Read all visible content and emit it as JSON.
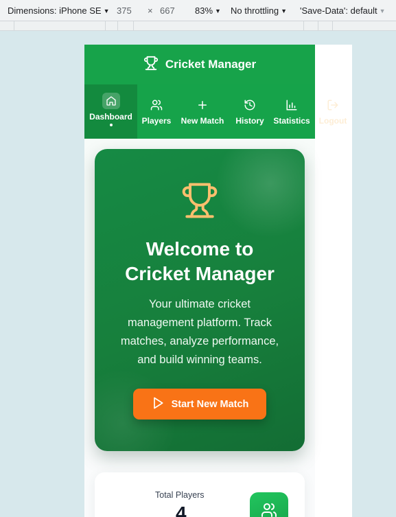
{
  "devtools": {
    "dimensions_label": "Dimensions: iPhone SE",
    "width": "375",
    "times": "×",
    "height": "667",
    "zoom": "83%",
    "throttling": "No throttling",
    "save_data": "'Save-Data': default"
  },
  "app": {
    "title": "Cricket Manager",
    "nav": [
      {
        "label": "Dashboard",
        "icon": "home-icon",
        "active": true
      },
      {
        "label": "Players",
        "icon": "users-icon"
      },
      {
        "label": "New Match",
        "icon": "plus-icon"
      },
      {
        "label": "History",
        "icon": "history-icon"
      },
      {
        "label": "Statistics",
        "icon": "bar-chart-icon"
      },
      {
        "label": "Logout",
        "icon": "logout-icon"
      }
    ]
  },
  "hero": {
    "heading_line1": "Welcome to",
    "heading_line2": "Cricket Manager",
    "text_line1": "Your ultimate cricket",
    "text_line2": "management platform. Track",
    "text_line3": "matches, analyze performance,",
    "text_line4": "and build winning teams.",
    "button_label": "Start New Match"
  },
  "stats": {
    "total_players_label": "Total Players",
    "total_players_value": "4"
  },
  "colors": {
    "primary_green": "#16a34a",
    "accent_orange": "#f97316",
    "trophy_gold": "#fbbf6e"
  }
}
